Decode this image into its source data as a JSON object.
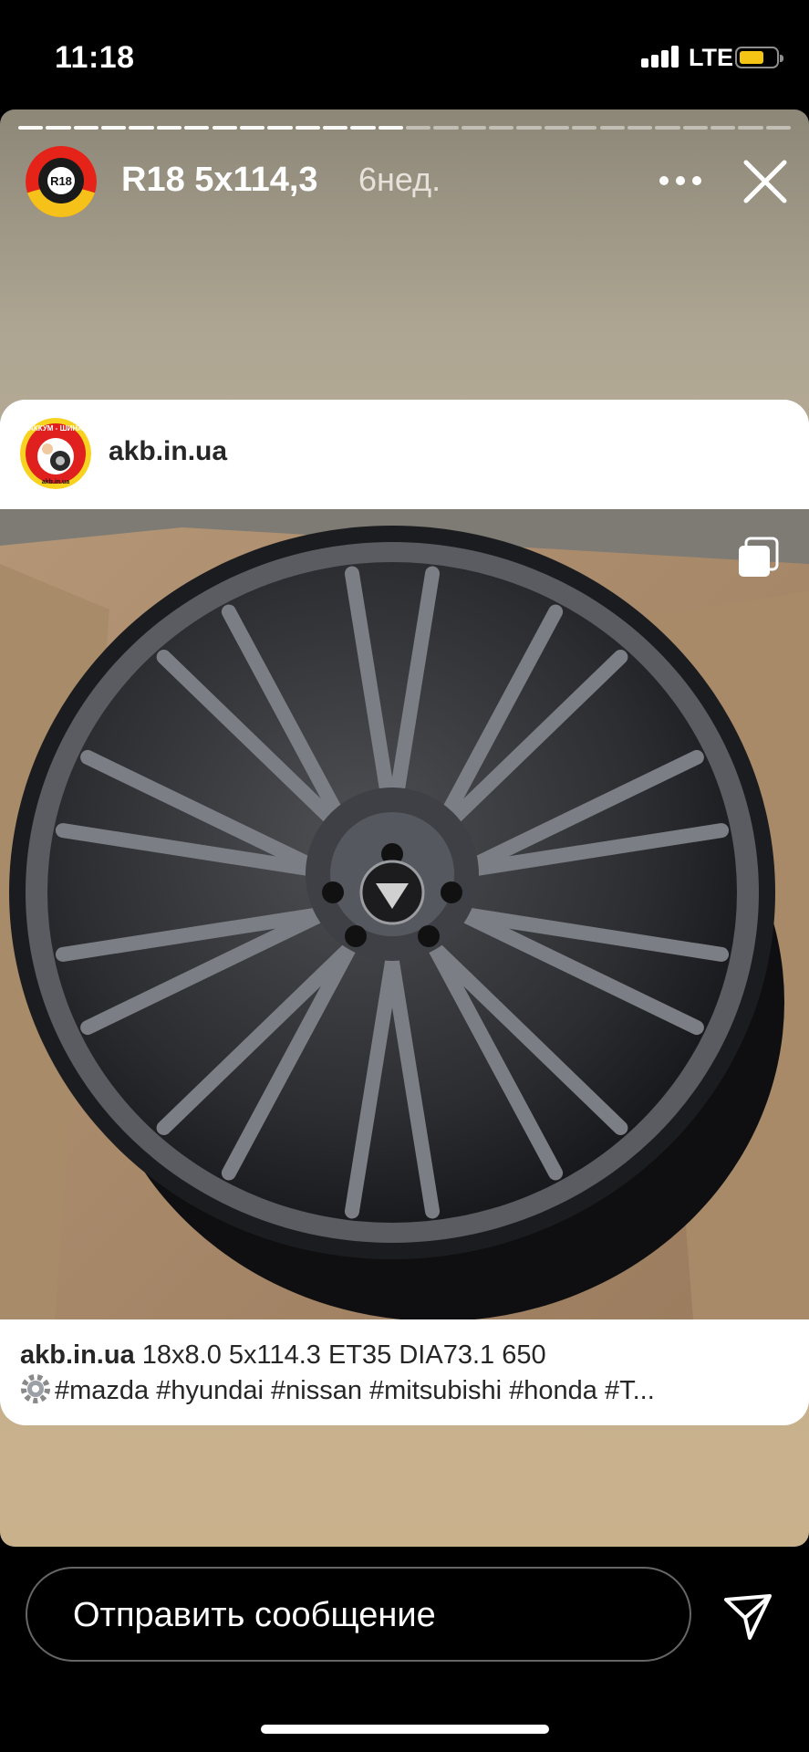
{
  "status_bar": {
    "time": "11:18",
    "network": "LTE",
    "battery_color": "#f4c515"
  },
  "story": {
    "title": "R18 5x114,3",
    "age": "6нед.",
    "avatar_badge": "R18",
    "progress": {
      "segments": 28,
      "viewed": 14
    }
  },
  "post": {
    "username": "akb.in.ua",
    "avatar_text_top": "АККУМ - ШИНА",
    "avatar_text_bottom": "akb.in.ua",
    "caption_user": "akb.in.ua",
    "caption_specs": "18x8.0 5x114.3 ET35 DIA73.1 650",
    "caption_tags": "#mazda #hyundai #nissan #mitsubishi #honda #T..."
  },
  "reply": {
    "placeholder": "Отправить сообщение"
  },
  "icons": [
    "signal-icon",
    "battery-icon",
    "more-icon",
    "close-icon",
    "multiple-photos-icon",
    "gear-icon",
    "send-icon"
  ]
}
